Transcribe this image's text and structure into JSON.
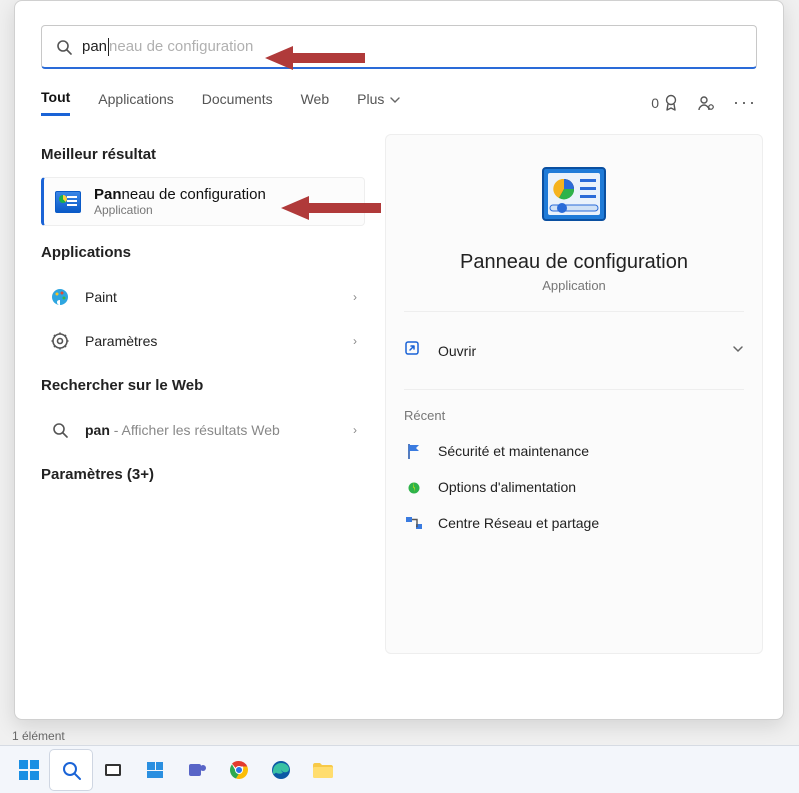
{
  "search": {
    "typed": "pan",
    "ghost": "neau de configuration"
  },
  "tabs": {
    "all": "Tout",
    "apps": "Applications",
    "docs": "Documents",
    "web": "Web",
    "more": "Plus"
  },
  "rewards": {
    "count": "0"
  },
  "left": {
    "best_h": "Meilleur résultat",
    "best_title_strong": "Pan",
    "best_title_rest": "neau de configuration",
    "best_sub": "Application",
    "apps_h": "Applications",
    "apps": [
      {
        "label": "Paint"
      },
      {
        "label": "Paramètres"
      }
    ],
    "web_h": "Rechercher sur le Web",
    "web_strong": "pan",
    "web_rest": " - Afficher les résultats Web",
    "settings_h": "Paramètres (3+)"
  },
  "right": {
    "title": "Panneau de configuration",
    "sub": "Application",
    "open": "Ouvrir",
    "recent_h": "Récent",
    "recent": [
      {
        "label": "Sécurité et maintenance"
      },
      {
        "label": "Options d'alimentation"
      },
      {
        "label": "Centre Réseau et partage"
      }
    ]
  },
  "status": "1 élément"
}
